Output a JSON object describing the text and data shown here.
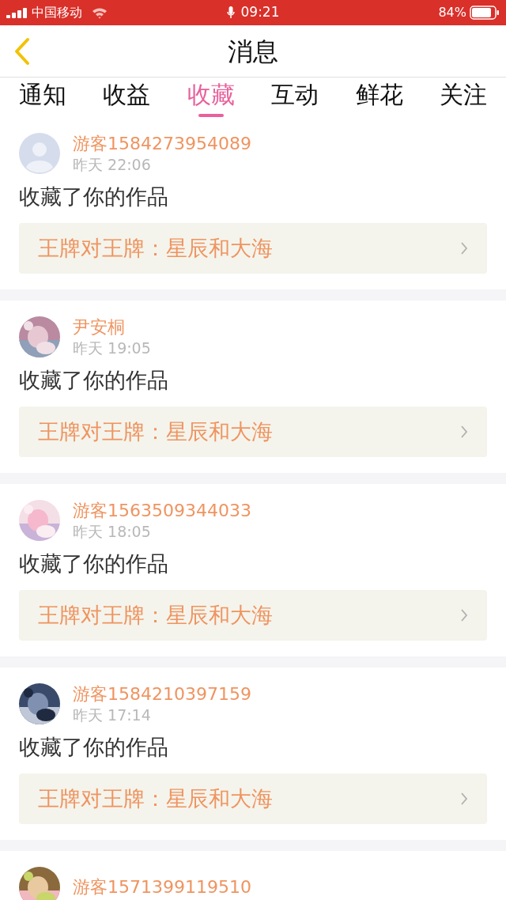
{
  "status_bar": {
    "carrier": "中国移动",
    "time": "09:21",
    "battery": "84%"
  },
  "header": {
    "title": "消息"
  },
  "tabs": [
    {
      "label": "通知",
      "selected": false
    },
    {
      "label": "收益",
      "selected": false
    },
    {
      "label": "收藏",
      "selected": true
    },
    {
      "label": "互动",
      "selected": false
    },
    {
      "label": "鲜花",
      "selected": false
    },
    {
      "label": "关注",
      "selected": false
    }
  ],
  "messages": [
    {
      "avatar": {
        "kind": "default"
      },
      "name": "游客1584273954089",
      "time": "昨天 22:06",
      "text": "收藏了你的作品",
      "work": "王牌对王牌：星辰和大海"
    },
    {
      "name": "尹安桐",
      "time": "昨天 19:05",
      "text": "收藏了你的作品",
      "work": "王牌对王牌：星辰和大海"
    },
    {
      "name": "游客1563509344033",
      "time": "昨天 18:05",
      "text": "收藏了你的作品",
      "work": "王牌对王牌：星辰和大海"
    },
    {
      "name": "游客1584210397159",
      "time": "昨天 17:14",
      "text": "收藏了你的作品",
      "work": "王牌对王牌：星辰和大海"
    },
    {
      "name": "游客1571399119510"
    }
  ]
}
